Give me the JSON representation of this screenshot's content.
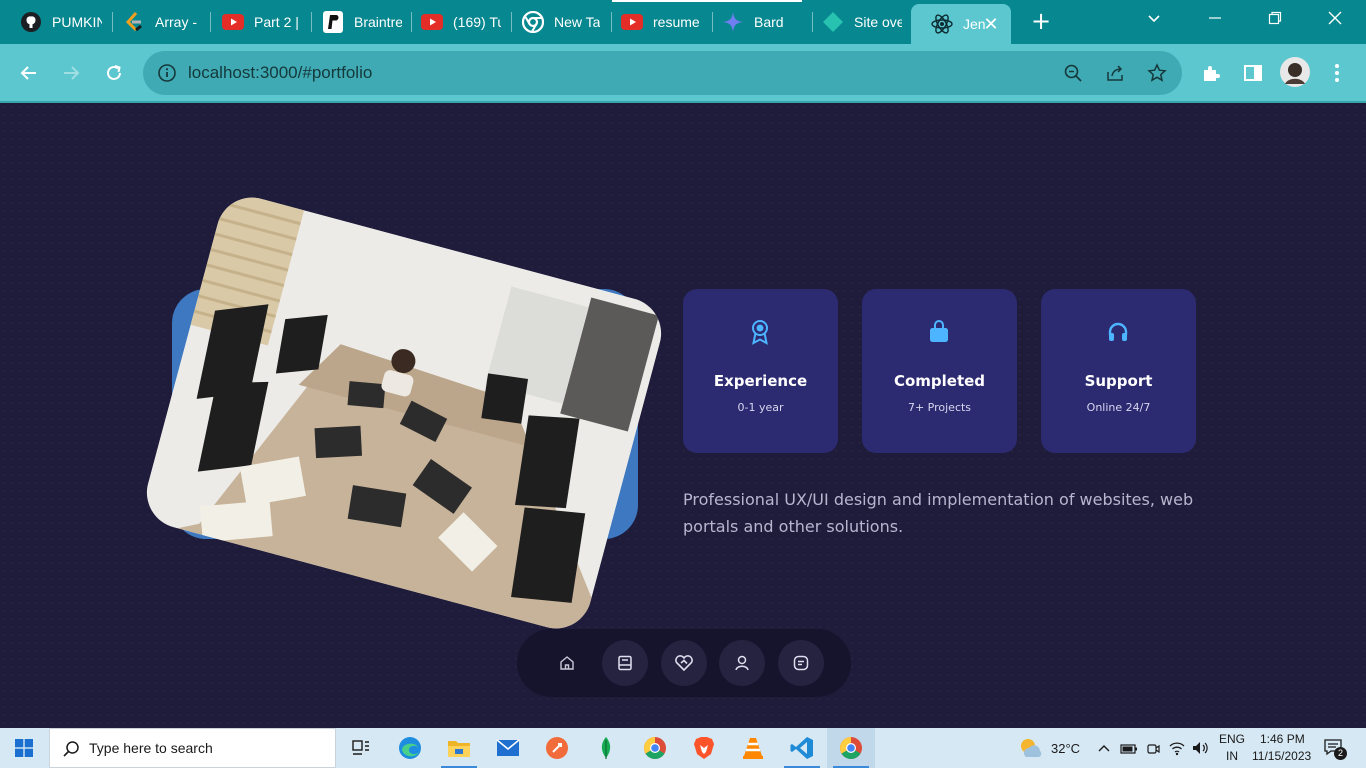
{
  "browser": {
    "tabs": [
      {
        "label": "PUMKIN",
        "icon": "github-icon"
      },
      {
        "label": "Array - ",
        "icon": "leetcode-icon"
      },
      {
        "label": "Part 2 |",
        "icon": "youtube-icon"
      },
      {
        "label": "Braintree",
        "icon": "paypal-icon"
      },
      {
        "label": "(169) Tu",
        "icon": "youtube-icon"
      },
      {
        "label": "New Tab",
        "icon": "chrome-icon"
      },
      {
        "label": "resume",
        "icon": "youtube-icon"
      },
      {
        "label": "Bard",
        "icon": "bard-icon"
      },
      {
        "label": "Site ove",
        "icon": "netlify-icon"
      },
      {
        "label": "Jen",
        "icon": "react-icon"
      }
    ],
    "new_tab_label": "+",
    "close_tab_label": "✕",
    "url": "localhost:3000/#portfolio"
  },
  "page": {
    "cards": [
      {
        "title": "Experience",
        "subtitle": "0-1 year",
        "icon": "award-icon"
      },
      {
        "title": "Completed",
        "subtitle": "7+ Projects",
        "icon": "briefcase-icon"
      },
      {
        "title": "Support",
        "subtitle": "Online 24/7",
        "icon": "headphones-icon"
      }
    ],
    "description": "Professional UX/UI design and implementation of websites, web portals and other solutions.",
    "nav": [
      "home-icon",
      "book-icon",
      "handshake-icon",
      "user-icon",
      "message-icon"
    ]
  },
  "taskbar": {
    "search_placeholder": "Type here to search",
    "weather": "32°C",
    "lang_top": "ENG",
    "lang_bottom": "IN",
    "time": "1:46 PM",
    "date": "11/15/2023",
    "notifications": "2"
  },
  "colors": {
    "tabstrip": "#07878f",
    "toolbar": "#5cc7cf",
    "page_bg": "#1f1c3b",
    "card_bg": "#2c2a70",
    "accent": "#4db5ff",
    "photo_backdrop": "#3d78c0"
  }
}
